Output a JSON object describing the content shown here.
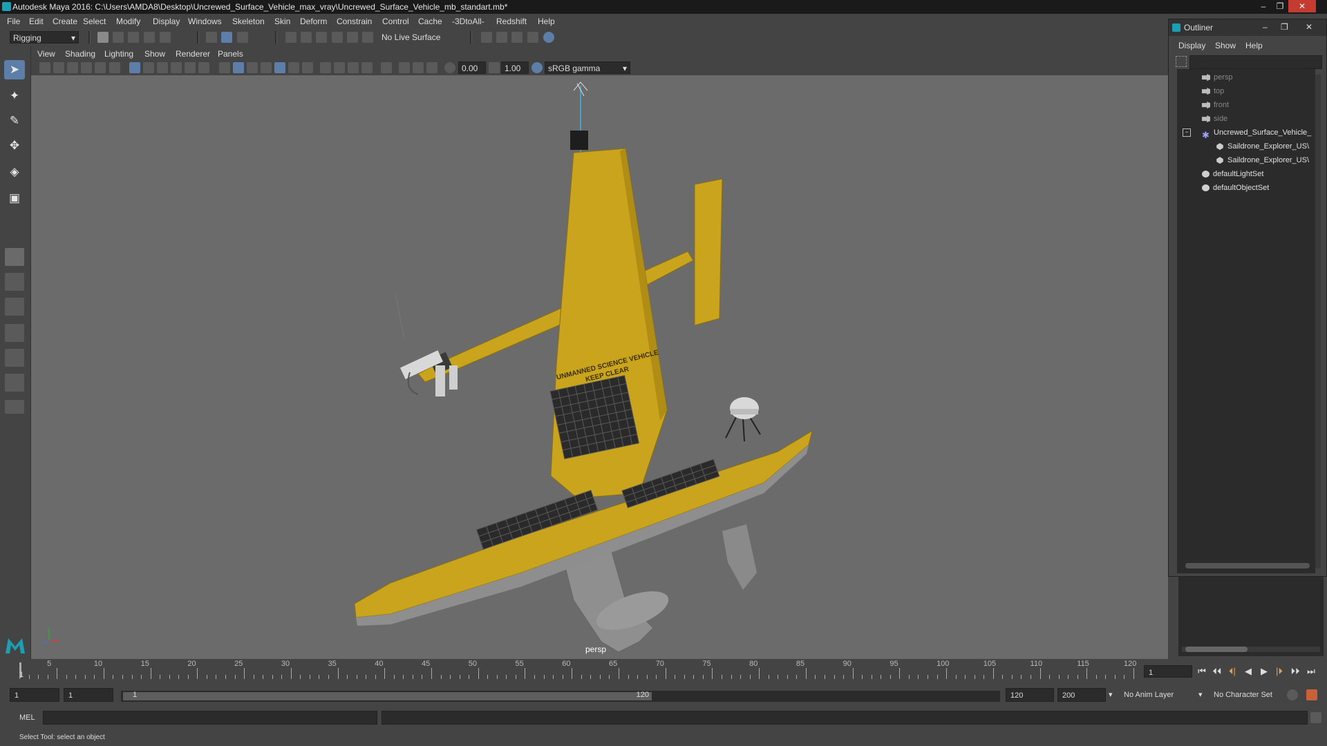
{
  "window": {
    "title": "Autodesk Maya 2016: C:\\Users\\AMDA8\\Desktop\\Uncrewed_Surface_Vehicle_max_vray\\Uncrewed_Surface_Vehicle_mb_standart.mb*",
    "minimize": "–",
    "restore": "❐",
    "close": "✕"
  },
  "menubar": [
    "File",
    "Edit",
    "Create",
    "Select",
    "Modify",
    "Display",
    "Windows",
    "Skeleton",
    "Skin",
    "Deform",
    "Constrain",
    "Control",
    "Cache",
    "-3DtoAll-",
    "Redshift",
    "Help"
  ],
  "statusline": {
    "menuset": "Rigging",
    "live_surface": "No Live Surface"
  },
  "panel": {
    "menus": [
      "View",
      "Shading",
      "Lighting",
      "Show",
      "Renderer",
      "Panels"
    ],
    "exposure": "0.00",
    "gamma": "1.00",
    "colorspace": "sRGB gamma",
    "camera": "persp"
  },
  "model": {
    "sail_text_line1": "UNMANNED SCIENCE VEHICLE",
    "sail_text_line2": "KEEP CLEAR",
    "hull_color": "#c9a41c",
    "keel_color": "#8a8a8a"
  },
  "outliner": {
    "title": "Outliner",
    "menus": [
      "Display",
      "Show",
      "Help"
    ],
    "items": [
      {
        "label": "persp",
        "icon": "camera-icon",
        "dim": true
      },
      {
        "label": "top",
        "icon": "camera-icon",
        "dim": true
      },
      {
        "label": "front",
        "icon": "camera-icon",
        "dim": true
      },
      {
        "label": "side",
        "icon": "camera-icon",
        "dim": true
      },
      {
        "label": "Uncrewed_Surface_Vehicle_",
        "icon": "group-icon",
        "dim": false
      },
      {
        "label": "Saildrone_Explorer_US\\",
        "icon": "mesh-icon",
        "dim": false
      },
      {
        "label": "Saildrone_Explorer_US\\",
        "icon": "mesh-icon",
        "dim": false
      },
      {
        "label": "defaultLightSet",
        "icon": "set-icon",
        "dim": false
      },
      {
        "label": "defaultObjectSet",
        "icon": "set-icon",
        "dim": false
      }
    ]
  },
  "timeline": {
    "ticks": [
      "5",
      "10",
      "15",
      "20",
      "25",
      "30",
      "35",
      "40",
      "45",
      "50",
      "55",
      "60",
      "65",
      "70",
      "75",
      "80",
      "85",
      "90",
      "95",
      "100",
      "105",
      "110",
      "115",
      "120"
    ],
    "start_tick": "1",
    "current_frame": "1"
  },
  "range": {
    "start": "1",
    "playback_start": "1",
    "range_start_label": "1",
    "range_end_label": "120",
    "playback_end": "120",
    "end": "200",
    "anim_layer": "No Anim Layer",
    "character_set": "No Character Set"
  },
  "commandline": {
    "mode": "MEL"
  },
  "helpline": {
    "text": "Select Tool: select an object"
  }
}
